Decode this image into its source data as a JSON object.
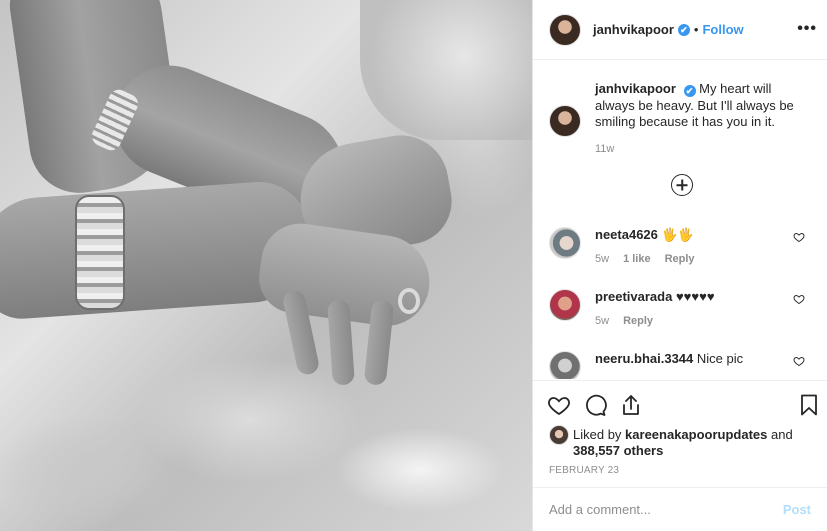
{
  "post": {
    "username": "janhvikapoor",
    "verified_mark": "✔",
    "separator": "•",
    "follow_label": "Follow",
    "more_label": "•••"
  },
  "caption": {
    "username": "janhvikapoor",
    "text": "My heart will always be heavy. But I'll always be smiling because it has you in it.",
    "age": "11w"
  },
  "comments": [
    {
      "username": "neeta4626",
      "text": "🖐🖐",
      "age": "5w",
      "likes": "1 like",
      "reply_label": "Reply"
    },
    {
      "username": "preetivarada",
      "text": "♥♥♥♥♥",
      "age": "5w",
      "reply_label": "Reply"
    },
    {
      "username": "neeru.bhai.3344",
      "text": "Nice pic"
    }
  ],
  "actions": {
    "icons": [
      "heart-icon",
      "comment-icon",
      "share-icon",
      "bookmark-icon"
    ]
  },
  "likes": {
    "prefix": "Liked by",
    "user": "kareenakapoorupdates",
    "and": "and",
    "others": "388,557 others"
  },
  "date": "FEBRUARY 23",
  "add_comment": {
    "placeholder": "Add a comment...",
    "post_label": "Post"
  },
  "colors": {
    "accent": "#3897f0",
    "post_disabled": "#b2dffc",
    "secondary_text": "#8e8e8e",
    "primary_text": "#262626"
  }
}
